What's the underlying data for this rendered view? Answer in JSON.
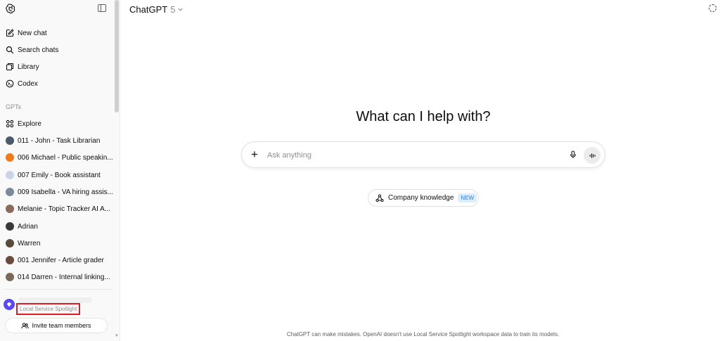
{
  "sidebar": {
    "nav": [
      {
        "label": "New chat",
        "icon": "new-chat-icon"
      },
      {
        "label": "Search chats",
        "icon": "search-icon"
      },
      {
        "label": "Library",
        "icon": "library-icon"
      },
      {
        "label": "Codex",
        "icon": "codex-icon"
      }
    ],
    "gpts_label": "GPTs",
    "explore_label": "Explore",
    "gpts": [
      {
        "label": "011 - John - Task Librarian",
        "color": "#4a5a6a"
      },
      {
        "label": "006 Michael - Public speakin...",
        "color": "#f07a1a"
      },
      {
        "label": "007 Emily - Book assistant",
        "color": "#c9d4e4"
      },
      {
        "label": "009 Isabella - VA hiring assis...",
        "color": "#7a8a9a"
      },
      {
        "label": "Melanie - Topic Tracker AI A...",
        "color": "#8a6a5a"
      },
      {
        "label": "Adrian",
        "color": "#3a3a3a"
      },
      {
        "label": "Warren",
        "color": "#5a4a3a"
      },
      {
        "label": "001 Jennifer - Article grader",
        "color": "#6a4a3a"
      },
      {
        "label": "014 Darren - Internal linking...",
        "color": "#7a6a5a"
      }
    ],
    "workspace_name": "Local Service Spotlight",
    "invite_label": "Invite team members"
  },
  "header": {
    "model_name": "ChatGPT",
    "model_version": "5"
  },
  "main": {
    "hero": "What can I help with?",
    "composer_placeholder": "Ask anything",
    "pill_label": "Company knowledge",
    "pill_badge": "NEW"
  },
  "footer": {
    "disclaimer": "ChatGPT can make mistakes. OpenAI doesn't use Local Service Spotlight workspace data to train its models."
  }
}
